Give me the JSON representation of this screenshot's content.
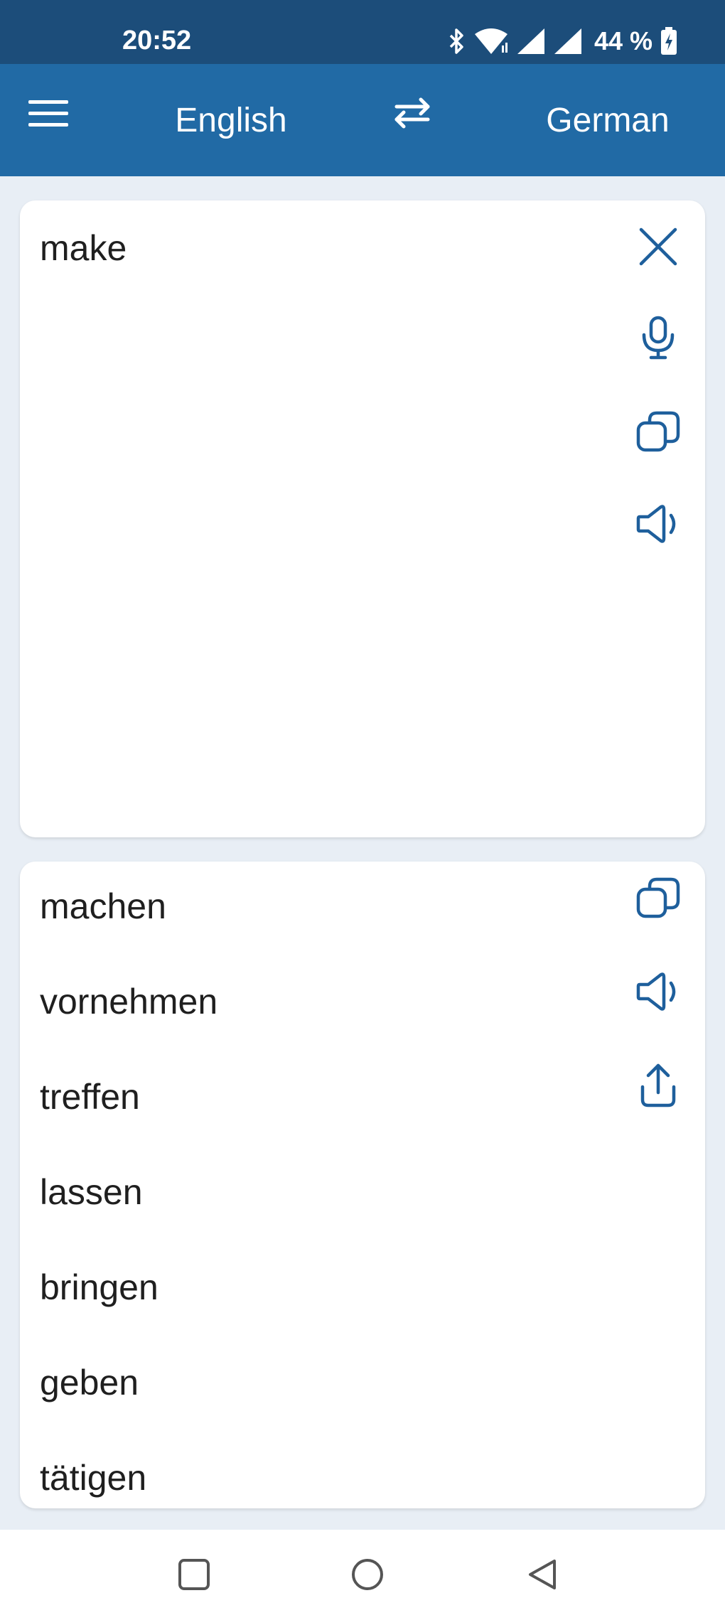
{
  "status_bar": {
    "time": "20:52",
    "battery": "44 %",
    "icons": [
      "bluetooth-icon",
      "wifi-icon",
      "signal-icon",
      "signal-icon",
      "battery-charging-icon"
    ]
  },
  "app_bar": {
    "menu_icon": "menu-icon",
    "source_language": "English",
    "swap_icon": "swap-arrows-icon",
    "target_language": "German"
  },
  "input": {
    "text": "make",
    "actions": [
      "close-icon",
      "microphone-icon",
      "copy-icon",
      "speaker-icon"
    ]
  },
  "result": {
    "translations": [
      "machen",
      "vornehmen",
      "treffen",
      "lassen",
      "bringen",
      "geben",
      "tätigen"
    ],
    "actions": [
      "copy-icon",
      "speaker-icon",
      "share-icon"
    ]
  },
  "nav_bar": {
    "buttons": [
      "recents-square-icon",
      "home-circle-icon",
      "back-triangle-icon"
    ]
  },
  "colors": {
    "status_bar": "#1c4d7a",
    "app_bar": "#216aa5",
    "background": "#e8eef5",
    "accent": "#1e5f9c",
    "text": "#1f1f1f"
  }
}
